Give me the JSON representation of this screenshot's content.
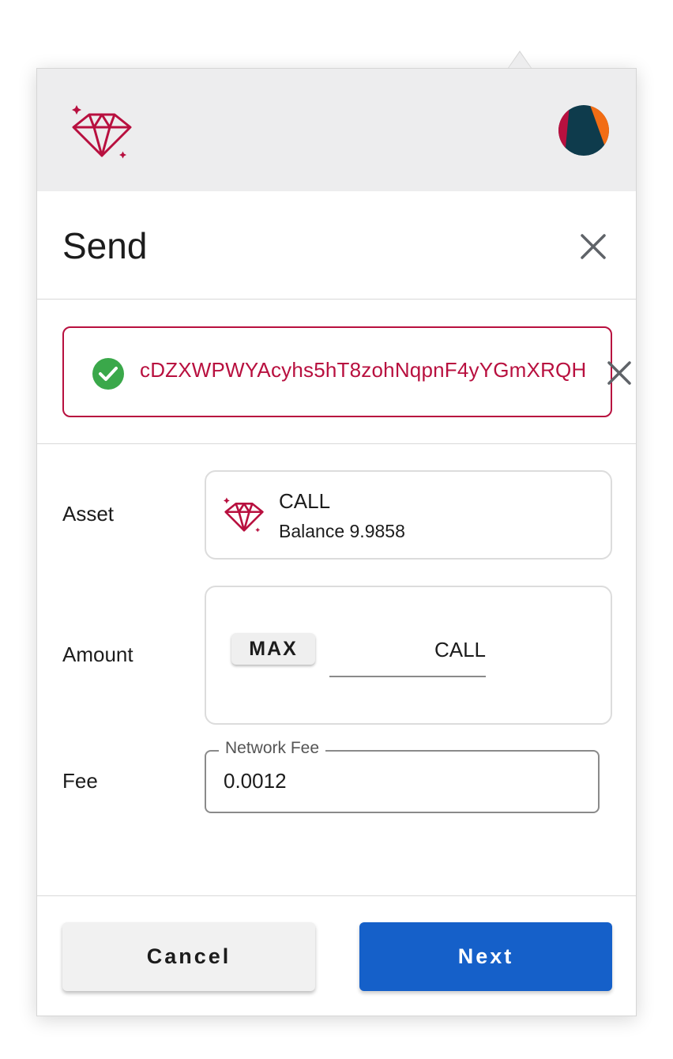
{
  "header": {
    "logo_icon": "diamond-logo-icon",
    "avatar_icon": "account-avatar",
    "brand_color": "#b8103f"
  },
  "send": {
    "title": "Send",
    "close_icon": "close-icon"
  },
  "recipient": {
    "address": "cDZXWPWYAcyhs5hT8zohNqpnF4yYGmXRQH",
    "status_icon": "check-circle-icon",
    "status_color": "#3aa84a",
    "clear_icon": "close-icon"
  },
  "asset": {
    "label": "Asset",
    "name": "CALL",
    "balance": "Balance 9.9858"
  },
  "amount": {
    "label": "Amount",
    "max_label": "MAX",
    "value": "",
    "unit": "CALL"
  },
  "fee": {
    "label": "Fee",
    "field_label": "Network Fee",
    "value": "0.0012"
  },
  "footer": {
    "cancel_label": "Cancel",
    "next_label": "Next",
    "next_color": "#1560c9"
  }
}
